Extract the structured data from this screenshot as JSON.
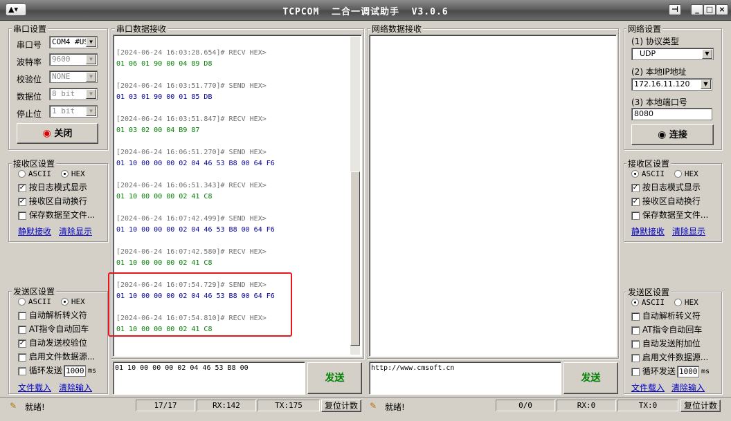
{
  "window": {
    "title": "TCPCOM  二合一调试助手  V3.0.6",
    "pin_icon": "pin-icon",
    "minimize": "_",
    "maximize": "□",
    "close": "×"
  },
  "serial": {
    "group_title": "串口设置",
    "port_label": "串口号",
    "port_value": "COM4 #US",
    "baud_label": "波特率",
    "baud_value": "9600",
    "parity_label": "校验位",
    "parity_value": "NONE",
    "databits_label": "数据位",
    "databits_value": "8 bit",
    "stopbits_label": "停止位",
    "stopbits_value": "1 bit",
    "toggle_button": "关闭"
  },
  "left_recv": {
    "group_title": "接收区设置",
    "ascii": "ASCII",
    "hex": "HEX",
    "log_mode": "按日志模式显示",
    "auto_wrap": "接收区自动换行",
    "save_file": "保存数据至文件...",
    "silent": "静默接收",
    "clear": "清除显示"
  },
  "left_send": {
    "group_title": "发送区设置",
    "ascii": "ASCII",
    "hex": "HEX",
    "auto_escape": "自动解析转义符",
    "at_cr": "AT指令自动回车",
    "auto_checksum": "自动发送校验位",
    "file_source": "启用文件数据源...",
    "loop_send": "循环发送",
    "loop_ms": "1000",
    "ms_unit": "ms",
    "load_file": "文件载入",
    "clear_input": "清除输入"
  },
  "serial_recv": {
    "title": "串口数据接收",
    "entries": [
      {
        "header": "[2024-06-24 16:03:28.654]# RECV HEX>",
        "data": "01 06 01 90 00 04 89 D8",
        "kind": "recv"
      },
      {
        "header": "[2024-06-24 16:03:51.770]# SEND HEX>",
        "data": "01 03 01 90 00 01 85 DB",
        "kind": "send"
      },
      {
        "header": "[2024-06-24 16:03:51.847]# RECV HEX>",
        "data": "01 03 02 00 04 B9 87",
        "kind": "recv"
      },
      {
        "header": "[2024-06-24 16:06:51.270]# SEND HEX>",
        "data": "01 10 00 00 00 02 04 46 53 B8 00 64 F6",
        "kind": "send"
      },
      {
        "header": "[2024-06-24 16:06:51.343]# RECV HEX>",
        "data": "01 10 00 00 00 02 41 C8",
        "kind": "recv"
      },
      {
        "header": "[2024-06-24 16:07:42.499]# SEND HEX>",
        "data": "01 10 00 00 00 02 04 46 53 B8 00 64 F6",
        "kind": "send"
      },
      {
        "header": "[2024-06-24 16:07:42.580]# RECV HEX>",
        "data": "01 10 00 00 00 02 41 C8",
        "kind": "recv"
      },
      {
        "header": "[2024-06-24 16:07:54.729]# SEND HEX>",
        "data": "01 10 00 00 00 02 04 46 53 B8 00 64 F6",
        "kind": "send"
      },
      {
        "header": "[2024-06-24 16:07:54.810]# RECV HEX>",
        "data": "01 10 00 00 00 02 41 C8",
        "kind": "recv"
      }
    ],
    "send_input": "01 10 00 00 00 02 04 46 53 B8 00",
    "send_button": "发送"
  },
  "net_recv": {
    "title": "网络数据接收",
    "send_input": "http://www.cmsoft.cn",
    "send_button": "发送"
  },
  "network": {
    "group_title": "网络设置",
    "protocol_label": "(1) 协议类型",
    "protocol_value": "UDP",
    "ip_label": "(2) 本地IP地址",
    "ip_value": "172.16.11.120",
    "port_label": "(3) 本地端口号",
    "port_value": "8080",
    "connect_button": "连接"
  },
  "right_recv": {
    "group_title": "接收区设置",
    "ascii": "ASCII",
    "hex": "HEX",
    "log_mode": "按日志模式显示",
    "auto_wrap": "接收区自动换行",
    "save_file": "保存数据至文件...",
    "silent": "静默接收",
    "clear": "清除显示"
  },
  "right_send": {
    "group_title": "发送区设置",
    "ascii": "ASCII",
    "hex": "HEX",
    "auto_escape": "自动解析转义符",
    "at_cr": "AT指令自动回车",
    "auto_append": "自动发送附加位",
    "file_source": "启用文件数据源...",
    "loop_send": "循环发送",
    "loop_ms": "1000",
    "ms_unit": "ms",
    "load_file": "文件载入",
    "clear_input": "清除输入"
  },
  "status_left": {
    "ready": "就绪!",
    "count": "17/17",
    "rx": "RX:142",
    "tx": "TX:175",
    "reset": "复位计数"
  },
  "status_right": {
    "ready": "就绪!",
    "count": "0/0",
    "rx": "RX:0",
    "tx": "TX:0",
    "reset": "复位计数"
  },
  "colors": {
    "highlight_box": "#e8141c",
    "send_text": "#0000a0",
    "recv_text": "#008000"
  }
}
